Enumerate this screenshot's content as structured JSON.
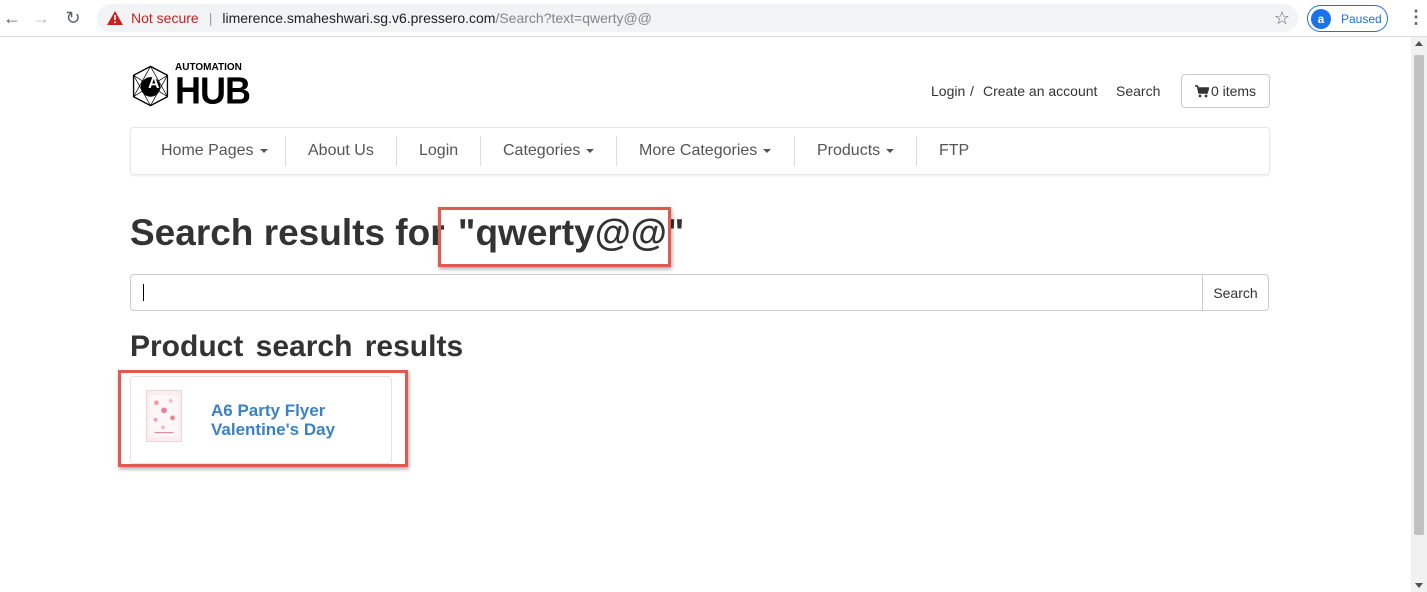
{
  "browser": {
    "not_secure_label": "Not secure",
    "url_host": "limerence.smaheshwari.sg.v6.pressero.com",
    "url_path": "/Search?text=qwerty@@",
    "profile_label": "Paused"
  },
  "header": {
    "logo_small": "AUTOMATION",
    "logo_big": "HUB",
    "logo_letter": "A",
    "login_label": "Login",
    "separator": "/",
    "create_account_label": "Create an account",
    "search_label": "Search",
    "cart_label": "0 items"
  },
  "navbar": {
    "items": [
      {
        "label": "Home Pages",
        "dropdown": true
      },
      {
        "label": "About Us",
        "dropdown": false
      },
      {
        "label": "Login",
        "dropdown": false
      },
      {
        "label": "Categories",
        "dropdown": true
      },
      {
        "label": "More Categories",
        "dropdown": true
      },
      {
        "label": "Products",
        "dropdown": true
      },
      {
        "label": "FTP",
        "dropdown": false
      }
    ]
  },
  "main": {
    "title_prefix": "Search results for ",
    "query_display": "\"qwerty@@\"",
    "search_input_value": "",
    "search_button_label": "Search",
    "product_heading": "Product search results",
    "products": [
      {
        "name": "A6 Party Flyer Valentine's Day"
      }
    ]
  },
  "colors": {
    "link": "#3b82c4",
    "highlight": "#e05a4f",
    "chrome_blue": "#1a73e8"
  }
}
